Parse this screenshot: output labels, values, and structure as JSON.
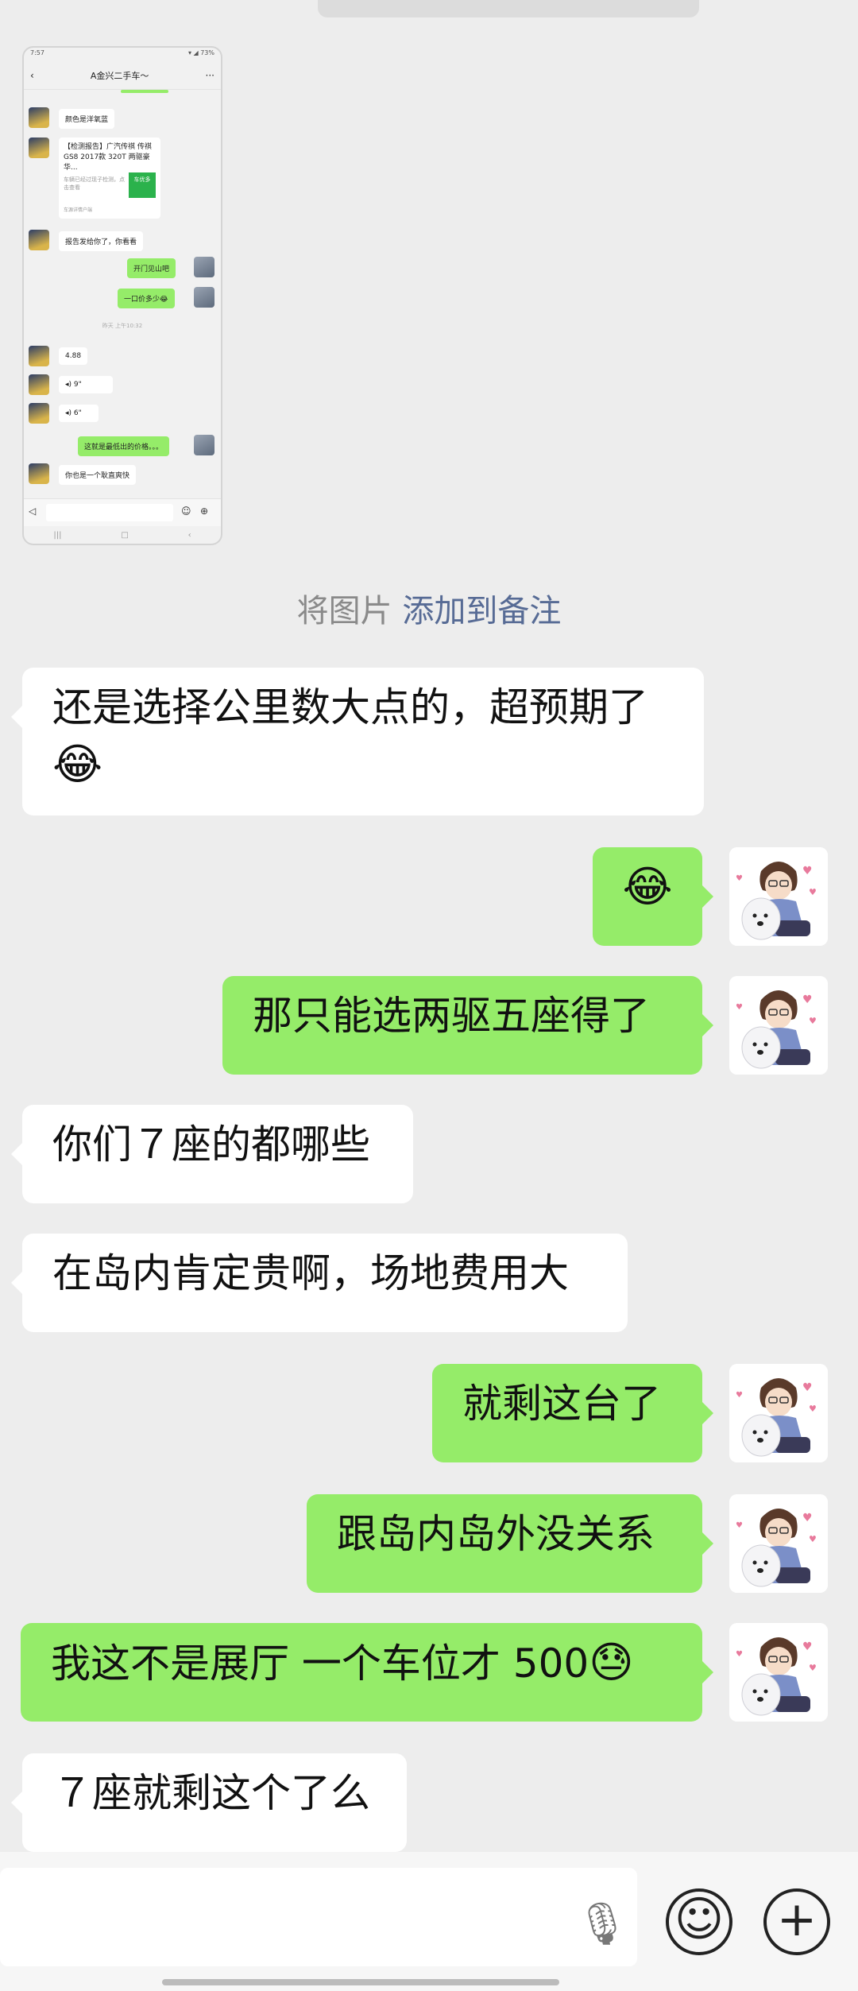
{
  "embedded_screenshot": {
    "status_time": "7:57",
    "status_right": "▾ ◢ 73%",
    "title": "A金兴二手车～",
    "more": "···",
    "msgs": {
      "color": "颜色是洋氧蓝",
      "card_title": "【检测报告】广汽传祺 传祺GS8 2017款 320T 两驱豪华...",
      "card_sub": "车辆已经过现子检测，点击查看",
      "card_thumb": "车优多",
      "card_source": "车源详情户端",
      "report": "报告发给你了，你看看",
      "reply1": "开门见山吧",
      "reply2": "一口价多少😂",
      "time": "昨天 上午10:32",
      "price": "4.88",
      "voice1": "◂) 9\"",
      "voice2": "◂) 6\"",
      "reply3": "这就是最低出的价格。。。",
      "last": "你也是一个耿直爽快"
    }
  },
  "note": {
    "prefix": "将图片",
    "link": "添加到备注"
  },
  "messages": [
    {
      "side": "left",
      "text": "还是选择公里数大点的，超预期了",
      "emoji": "😂"
    },
    {
      "side": "right",
      "emoji": "😂"
    },
    {
      "side": "right",
      "text": "那只能选两驱五座得了"
    },
    {
      "side": "left",
      "text": "你们７座的都哪些"
    },
    {
      "side": "left",
      "text": "在岛内肯定贵啊，场地费用大"
    },
    {
      "side": "right",
      "text": "就剩这台了"
    },
    {
      "side": "right",
      "text": "跟岛内岛外没关系"
    },
    {
      "side": "right",
      "text": "我这不是展厅 一个车位才 500",
      "emoji": "😓"
    },
    {
      "side": "left",
      "text": "７座就剩这个了么"
    }
  ],
  "input_bar": {
    "mic_icon": "microphone-icon",
    "emoji_icon": "emoji-icon",
    "plus_icon": "plus-icon",
    "emoji_glyph": "☺",
    "plus_glyph": "+"
  }
}
